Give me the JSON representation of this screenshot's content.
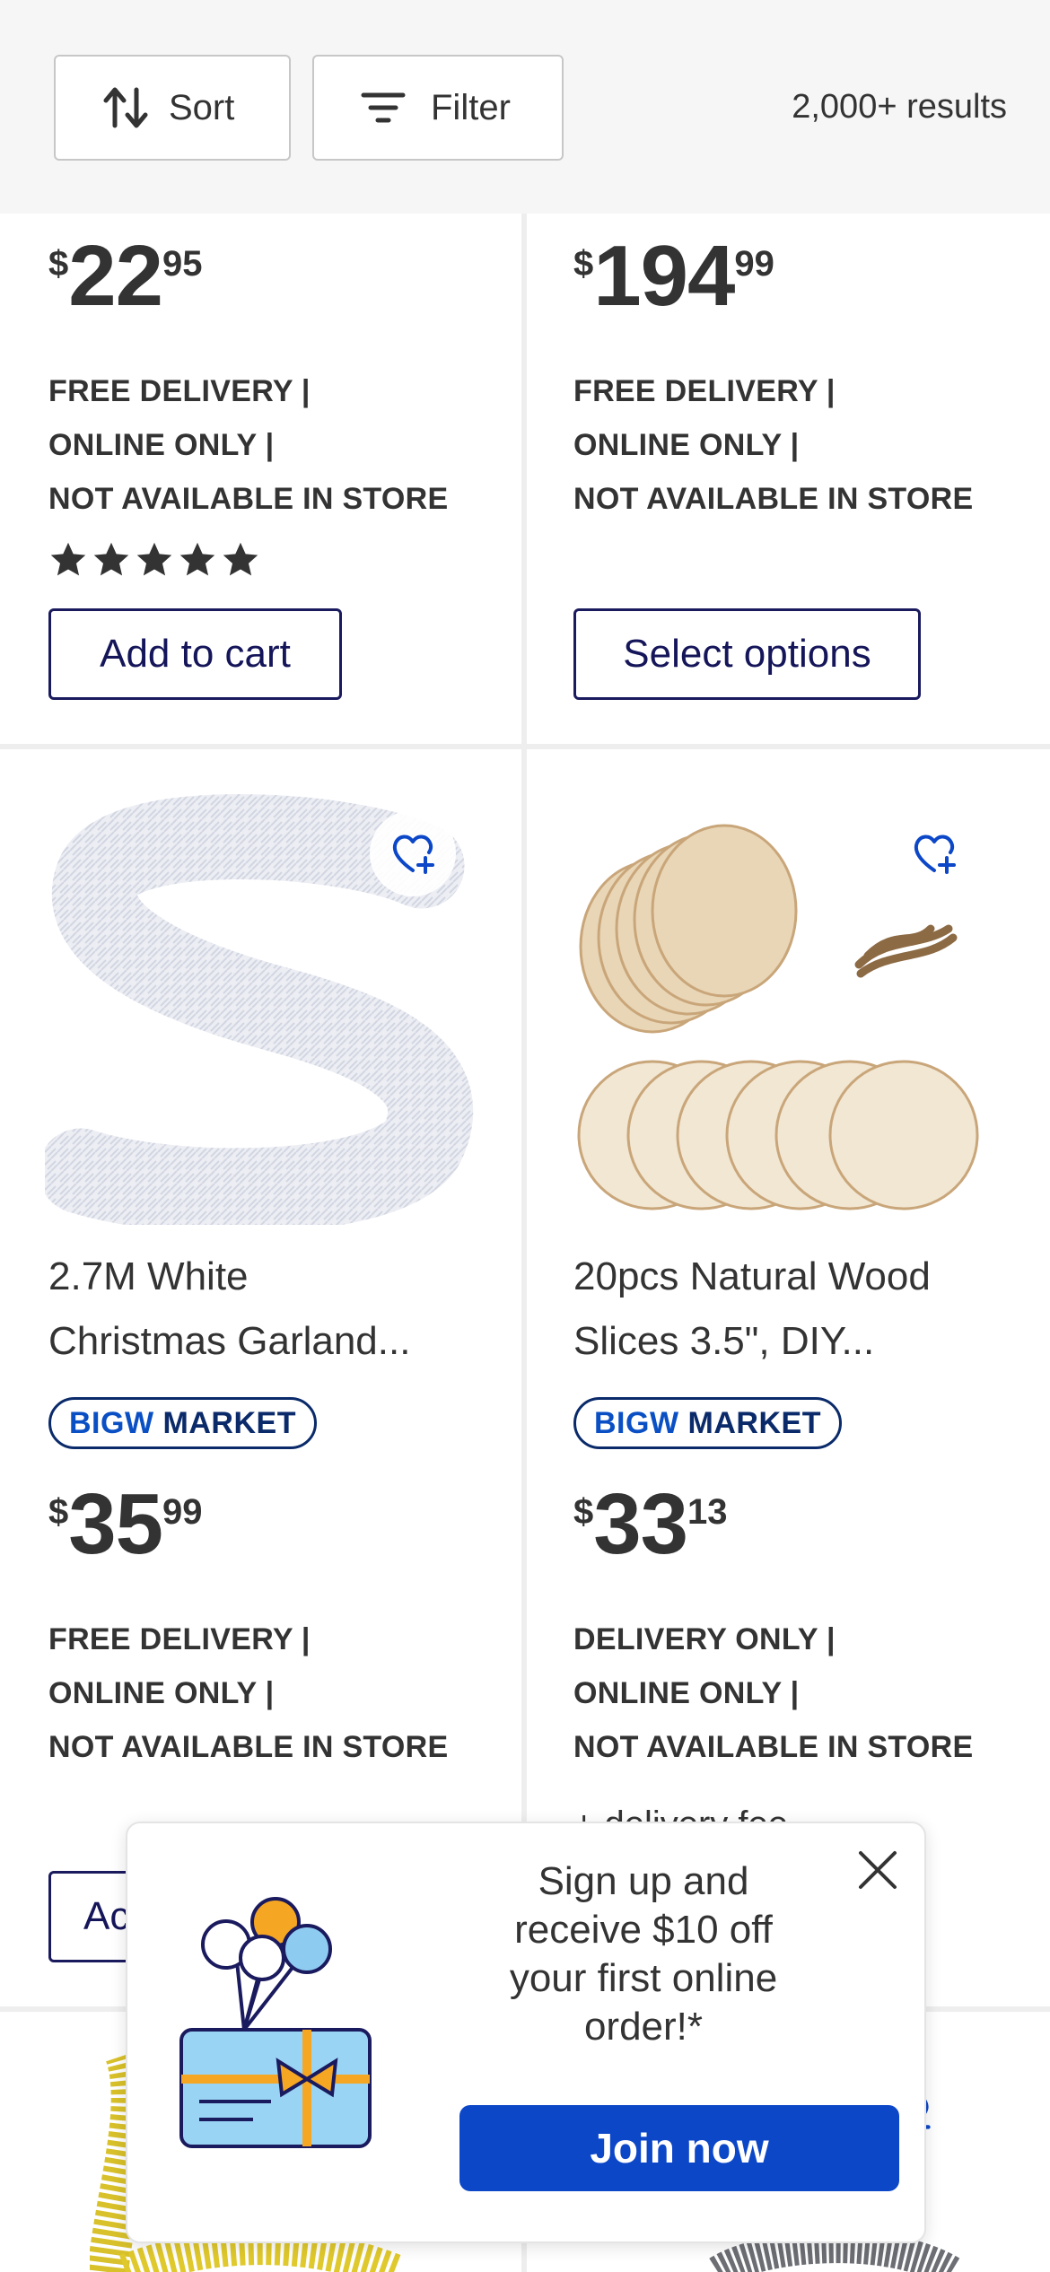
{
  "toolbar": {
    "sort_label": "Sort",
    "filter_label": "Filter",
    "results_count": "2,000+ results",
    "icons": [
      "sort-arrows-icon",
      "filter-lines-icon"
    ]
  },
  "products": [
    {
      "price": {
        "currency": "$",
        "dollars": "22",
        "cents": "95"
      },
      "delivery": [
        "FREE DELIVERY  |",
        "ONLINE ONLY  |",
        "NOT AVAILABLE IN STORE"
      ],
      "rating_stars": 5,
      "button_label": "Add to cart"
    },
    {
      "price": {
        "currency": "$",
        "dollars": "194",
        "cents": "99"
      },
      "delivery": [
        "FREE DELIVERY  |",
        "ONLINE ONLY  |",
        "NOT AVAILABLE IN STORE"
      ],
      "button_label": "Select options"
    },
    {
      "title": "2.7M White Christmas Garland...",
      "title_lines": [
        "2.7M White",
        "Christmas Garland..."
      ],
      "badge": {
        "brand": "BIGW",
        "market": "MARKET"
      },
      "price": {
        "currency": "$",
        "dollars": "35",
        "cents": "99"
      },
      "delivery": [
        "FREE DELIVERY  |",
        "ONLINE ONLY  |",
        "NOT AVAILABLE IN STORE"
      ],
      "button_label": "Ac"
    },
    {
      "title": "20pcs Natural Wood Slices 3.5\", DIY...",
      "title_lines": [
        "20pcs Natural Wood",
        "Slices 3.5\", DIY..."
      ],
      "badge": {
        "brand": "BIGW",
        "market": "MARKET"
      },
      "price": {
        "currency": "$",
        "dollars": "33",
        "cents": "13"
      },
      "delivery": [
        "DELIVERY ONLY  |",
        "ONLINE ONLY  |",
        "NOT AVAILABLE IN STORE"
      ],
      "extra": "+ delivery fee"
    }
  ],
  "popup": {
    "message": "Sign up and receive $10 off your first online order!*",
    "message_lines": [
      "Sign up and",
      "receive $10 off",
      "your first online",
      "order!*"
    ],
    "button_label": "Join now"
  },
  "colors": {
    "brand_blue": "#0c47c8",
    "navy": "#15155a",
    "toolbar_bg": "#f6f6f6"
  }
}
